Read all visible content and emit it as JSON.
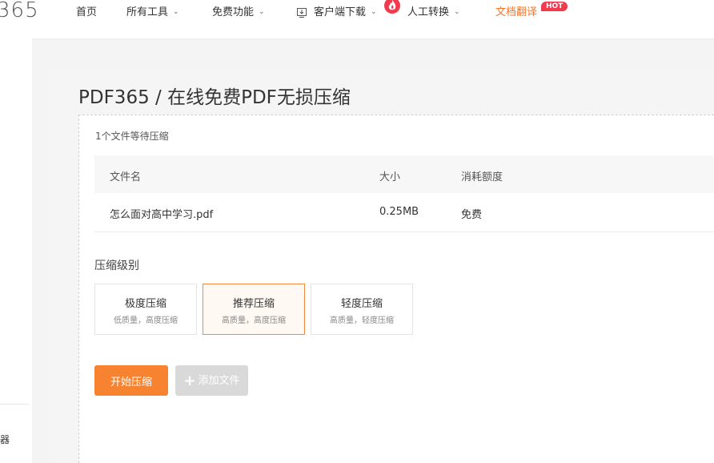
{
  "header": {
    "logo": "365",
    "nav": [
      {
        "label": "首页"
      },
      {
        "label": "所有工具"
      },
      {
        "label": "免费功能"
      },
      {
        "label": "客户端下载"
      },
      {
        "label": "人工转换"
      },
      {
        "label": "文档翻译"
      }
    ],
    "hot_badge": "HOT",
    "accent_color": "#f5742a"
  },
  "left_strip": {
    "tiny_text": "器"
  },
  "page": {
    "title": "PDF365 / 在线免费PDF无损压缩",
    "waiting_text": "1个文件等待压缩",
    "table": {
      "headers": [
        "文件名",
        "大小",
        "消耗额度"
      ],
      "rows": [
        {
          "name": "怎么面对高中学习.pdf",
          "size": "0.25MB",
          "cost": "免费"
        }
      ]
    },
    "level_label": "压缩级别",
    "levels": [
      {
        "title": "极度压缩",
        "desc": "低质量，高度压缩",
        "selected": false
      },
      {
        "title": "推荐压缩",
        "desc": "高质量，高度压缩",
        "selected": true
      },
      {
        "title": "轻度压缩",
        "desc": "高质量，轻度压缩",
        "selected": false
      }
    ],
    "start_button": "开始压缩",
    "add_button": "添加文件",
    "primary_color": "#f7822f"
  }
}
